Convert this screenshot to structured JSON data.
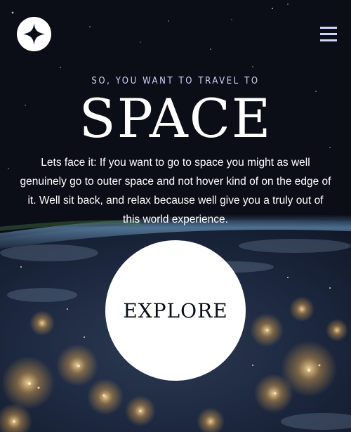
{
  "header": {
    "logo_icon": "star-logo-icon",
    "menu_icon": "hamburger-menu-icon"
  },
  "hero": {
    "eyebrow": "SO, YOU WANT TO TRAVEL TO",
    "title": "SPACE",
    "description": "Lets face it: If you want to go to space you might as well genuinely go to outer space and not hover kind of on the edge of it. Well sit back, and relax because well give you a truly out of this world experience.",
    "cta_label": "EXPLORE"
  },
  "colors": {
    "background": "#0b0d17",
    "accent": "#d0d6f9",
    "text": "#ffffff"
  }
}
